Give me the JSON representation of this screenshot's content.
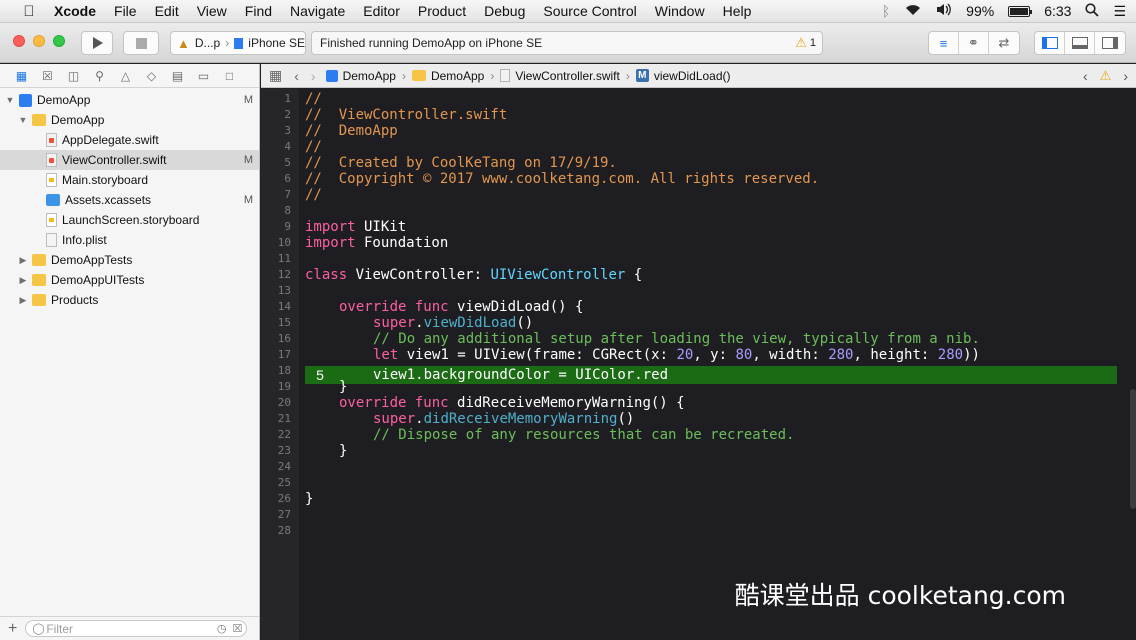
{
  "menubar": {
    "app": "Xcode",
    "items": [
      "File",
      "Edit",
      "View",
      "Find",
      "Navigate",
      "Editor",
      "Product",
      "Debug",
      "Source Control",
      "Window",
      "Help"
    ],
    "battery": "99%",
    "time": "6:33"
  },
  "toolbar": {
    "scheme_target": "D...p",
    "scheme_device": "iPhone SE",
    "activity": "Finished running DemoApp on iPhone SE",
    "warning_count": "1"
  },
  "navigator": {
    "tree": [
      {
        "label": "DemoApp",
        "badge": "M"
      },
      {
        "label": "DemoApp",
        "badge": ""
      },
      {
        "label": "AppDelegate.swift",
        "badge": ""
      },
      {
        "label": "ViewController.swift",
        "badge": "M"
      },
      {
        "label": "Main.storyboard",
        "badge": ""
      },
      {
        "label": "Assets.xcassets",
        "badge": "M"
      },
      {
        "label": "LaunchScreen.storyboard",
        "badge": ""
      },
      {
        "label": "Info.plist",
        "badge": ""
      },
      {
        "label": "DemoAppTests",
        "badge": ""
      },
      {
        "label": "DemoAppUITests",
        "badge": ""
      },
      {
        "label": "Products",
        "badge": ""
      }
    ],
    "filter_placeholder": "Filter"
  },
  "jumpbar": {
    "crumbs": [
      "DemoApp",
      "DemoApp",
      "ViewController.swift",
      "viewDidLoad()"
    ]
  },
  "editor": {
    "line_numbers": [
      "1",
      "2",
      "3",
      "4",
      "5",
      "6",
      "7",
      "8",
      "9",
      "10",
      "11",
      "12",
      "13",
      "14",
      "15",
      "16",
      "17",
      "18",
      "19",
      "20",
      "21",
      "22",
      "23",
      "24",
      "25",
      "26",
      "27",
      "28"
    ],
    "breakpoint_label": "5",
    "code": {
      "l1": "//",
      "l2": "//  ViewController.swift",
      "l3": "//  DemoApp",
      "l4": "//",
      "l5": "//  Created by CoolKeTang on 17/9/19.",
      "l6": "//  Copyright © 2017 www.coolketang.com. All rights reserved.",
      "l7": "//",
      "import": "import",
      "uikit": " UIKit",
      "foundation": " Foundation",
      "class": "class",
      "classname": " ViewController: ",
      "superclass": "UIViewController",
      "brace_open": " {",
      "override": "override",
      "func": "func",
      "vdl": " viewDidLoad() {",
      "super": "super",
      "dot": ".",
      "super_vdl": "viewDidLoad",
      "parens": "()",
      "comment16": "// Do any additional setup after loading the view, typically from a nib.",
      "let": "let",
      "l17a": " view1 = UIView(frame: CGRect(x: ",
      "n20": "20",
      "l17b": ", y: ",
      "n80": "80",
      "l17c": ", width: ",
      "n280a": "280",
      "l17d": ", height: ",
      "n280b": "280",
      "l17e": "))",
      "l18": "view1.backgroundColor = UIColor.red",
      "brace_close": "}",
      "dmw": " didReceiveMemoryWarning() {",
      "super_dmw": "didReceiveMemoryWarning",
      "comment22": "// Dispose of any resources that can be recreated."
    }
  },
  "watermark": "酷课堂出品 coolketang.com"
}
